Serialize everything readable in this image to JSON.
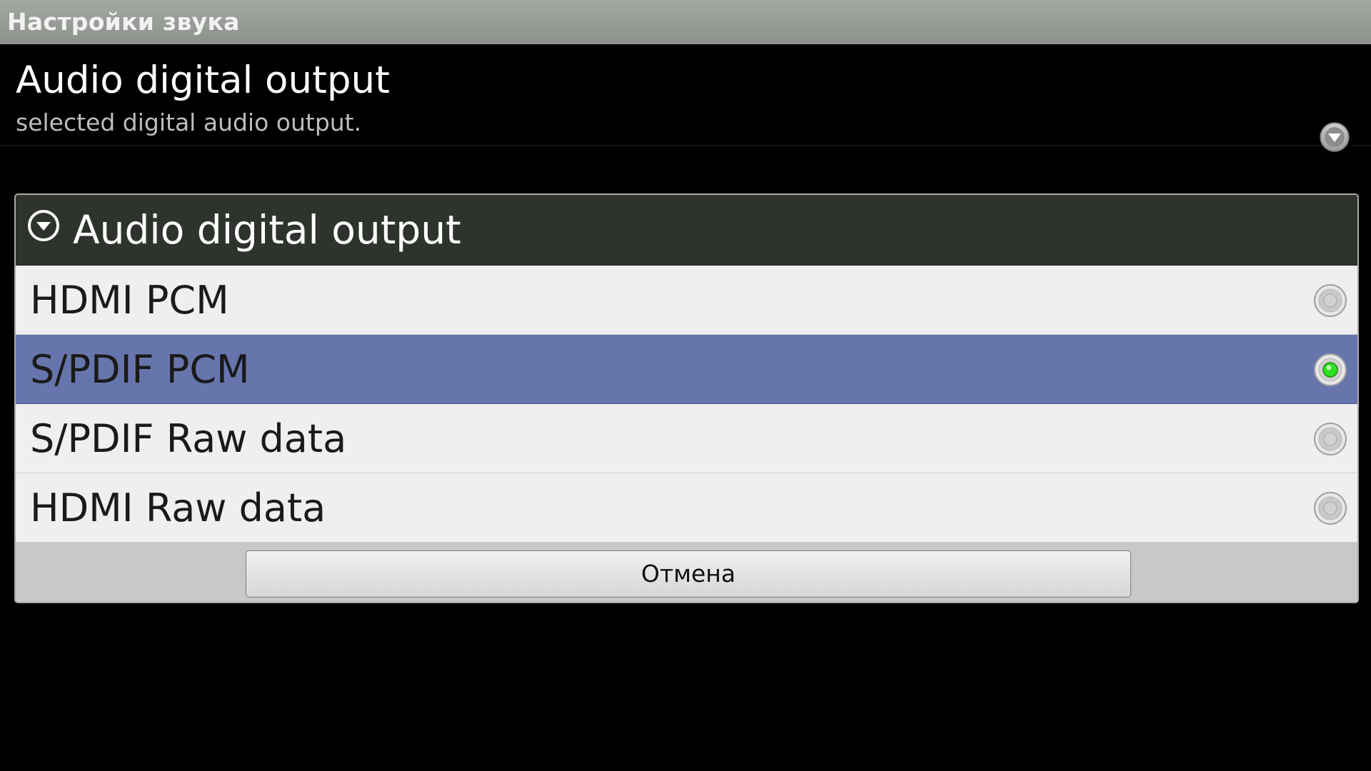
{
  "window": {
    "title": "Настройки звука"
  },
  "preference": {
    "title": "Audio digital output",
    "summary": "selected digital audio output.",
    "icon": "dropdown-arrow-icon"
  },
  "dialog": {
    "title": "Audio digital output",
    "icon": "dropdown-arrow-icon",
    "options": [
      {
        "label": "HDMI PCM",
        "selected": false
      },
      {
        "label": "S/PDIF PCM",
        "selected": true
      },
      {
        "label": "S/PDIF Raw data",
        "selected": false
      },
      {
        "label": "HDMI Raw data",
        "selected": false
      }
    ],
    "cancel_label": "Отмена"
  },
  "colors": {
    "titlebar": "#9a9e98",
    "dialog_header": "#2e332d",
    "selected_row": "#6775ad",
    "radio_on": "#2ee01f"
  }
}
